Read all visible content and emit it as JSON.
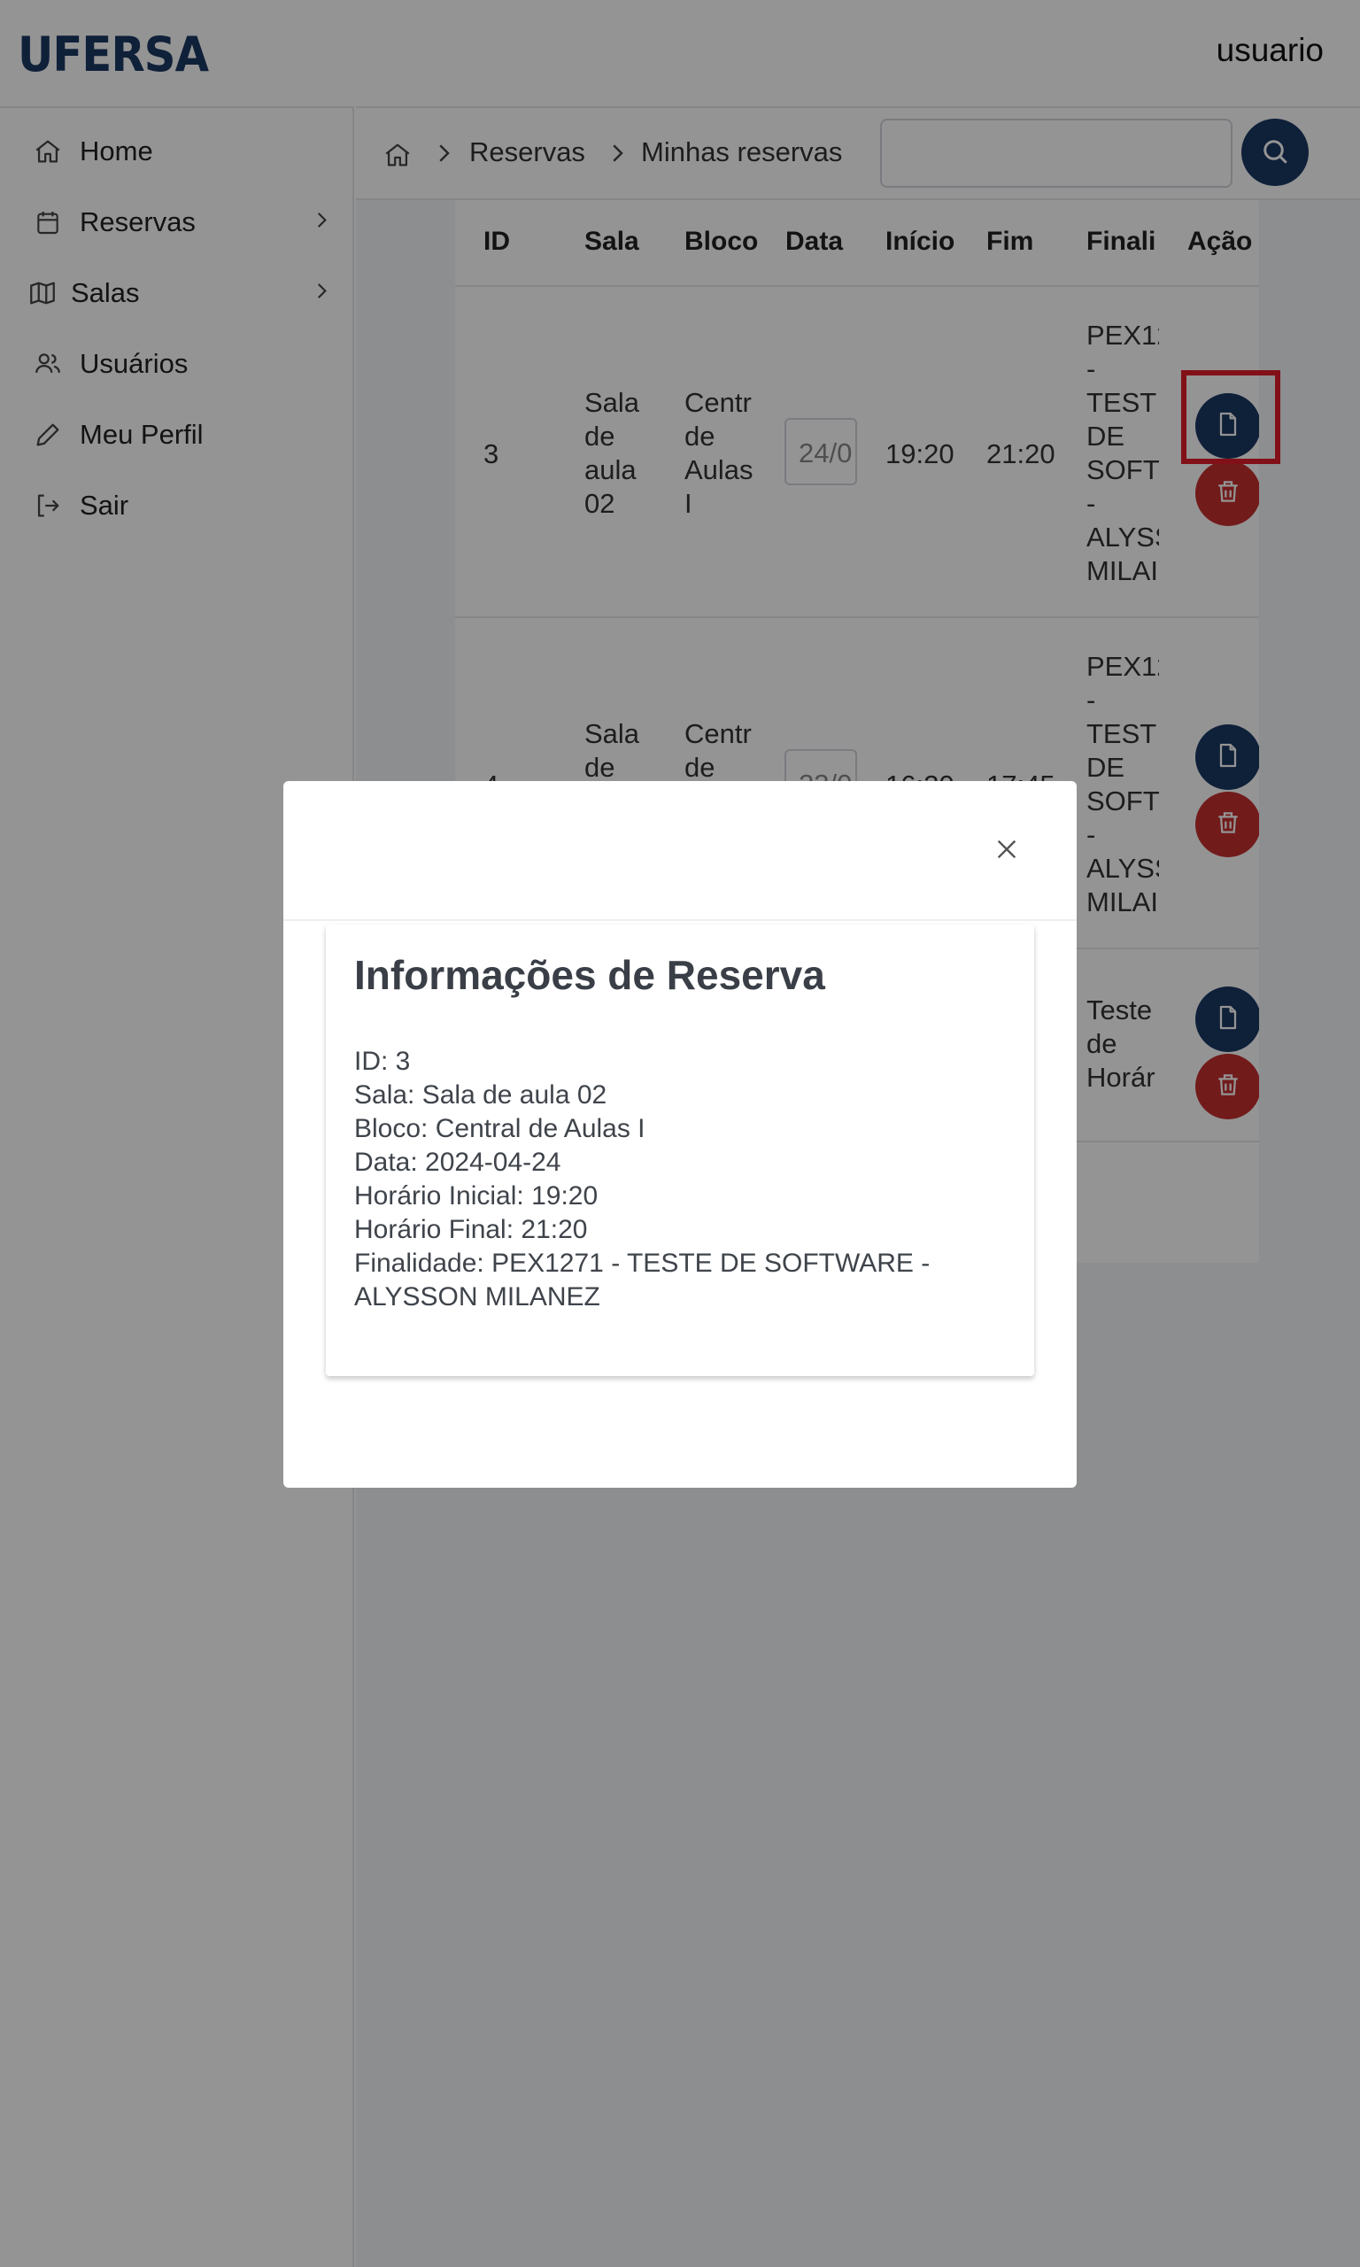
{
  "header": {
    "logo": "UFERSA",
    "user": "usuario"
  },
  "sidebar": {
    "items": [
      {
        "label": "Home",
        "icon": "home-icon"
      },
      {
        "label": "Reservas",
        "icon": "calendar-icon",
        "has_submenu": true
      },
      {
        "label": "Salas",
        "icon": "map-icon",
        "has_submenu": true
      },
      {
        "label": "Usuários",
        "icon": "users-icon"
      },
      {
        "label": "Meu Perfil",
        "icon": "pencil-icon"
      },
      {
        "label": "Sair",
        "icon": "logout-icon"
      }
    ]
  },
  "breadcrumb": {
    "items": [
      "Reservas",
      "Minhas reservas"
    ]
  },
  "search": {
    "value": "",
    "placeholder": ""
  },
  "table": {
    "headers": [
      "ID",
      "Sala",
      "Bloco",
      "Data",
      "Início",
      "Fim",
      "Finali",
      "Ação"
    ],
    "rows": [
      {
        "id": "3",
        "sala": "Sala\nde\naula\n02",
        "bloco": "Centr\nde\nAulas\nI",
        "data": "24/0",
        "inicio": "19:20",
        "fim": "21:20",
        "finalidade": "PEX12\n-\nTESTI\nDE\nSOFTV\n-\nALYSS\nMILAI"
      },
      {
        "id": "4",
        "sala": "Sala\nde",
        "bloco": "Centr\nde",
        "data": "23/0",
        "inicio": "16:20",
        "fim": "17:45",
        "finalidade": "PEX12\n-\nTESTI\nDE\nSOFTV\n-\nALYSS\nMILAI"
      },
      {
        "id": "",
        "sala": "",
        "bloco": "",
        "data": "",
        "inicio": "",
        "fim": "",
        "finalidade": "Teste\nde\nHorár"
      }
    ]
  },
  "modal": {
    "title": "Informações de Reserva",
    "lines": [
      "ID: 3",
      "Sala: Sala de aula 02",
      "Bloco: Central de Aulas I",
      "Data: 2024-04-24",
      "Horário Inicial: 19:20",
      "Horário Final: 21:20",
      "Finalidade: PEX1271 - TESTE DE SOFTWARE -",
      "ALYSSON MILANEZ"
    ]
  },
  "colors": {
    "brand": "#1b3763",
    "danger": "#c53030",
    "highlight": "#e11d2a"
  }
}
